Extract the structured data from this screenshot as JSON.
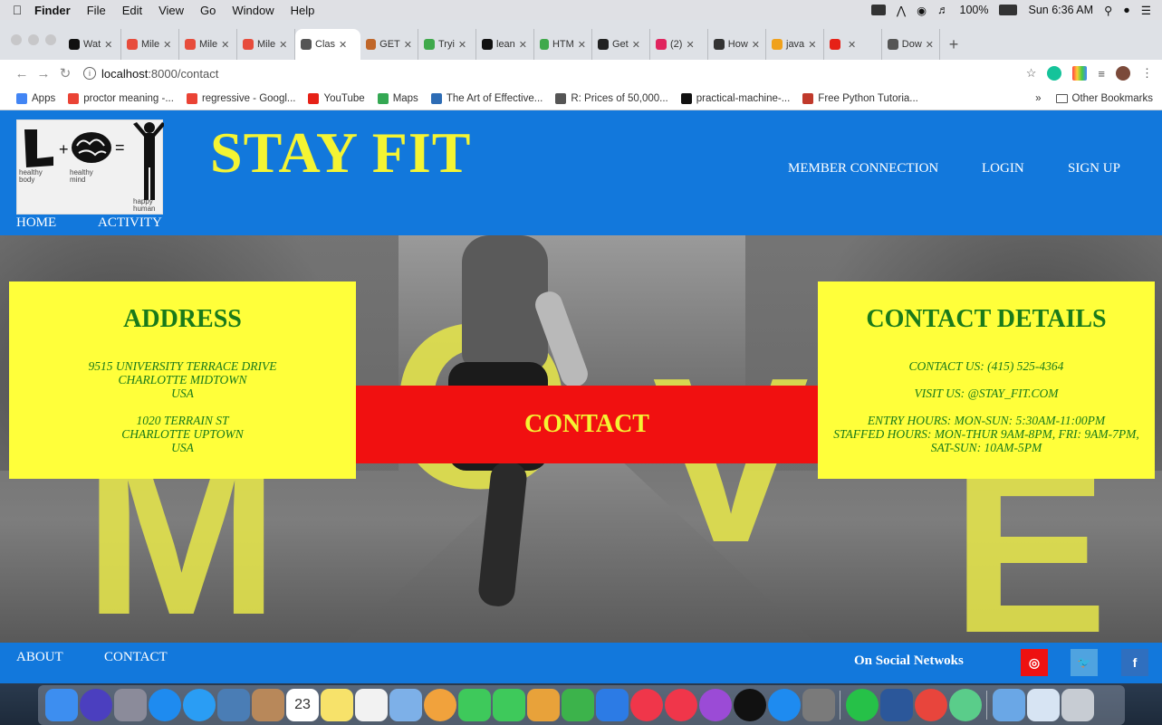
{
  "menubar": {
    "apple": "",
    "items": [
      "Finder",
      "File",
      "Edit",
      "View",
      "Go",
      "Window",
      "Help"
    ],
    "battery": "100%",
    "clock": "Sun 6:36 AM"
  },
  "browser": {
    "tabs": [
      {
        "label": "Wat",
        "color": "#111111"
      },
      {
        "label": "Mile",
        "color": "#e74c3c"
      },
      {
        "label": "Mile",
        "color": "#e74c3c"
      },
      {
        "label": "Mile",
        "color": "#e74c3c"
      },
      {
        "label": "Clas",
        "color": "#555555",
        "active": true
      },
      {
        "label": "GET",
        "color": "#c0672a"
      },
      {
        "label": "Tryi",
        "color": "#3fa94b"
      },
      {
        "label": "lean",
        "color": "#111111"
      },
      {
        "label": "HTM",
        "color": "#3fa94b"
      },
      {
        "label": "Get",
        "color": "#222222"
      },
      {
        "label": "(2)",
        "color": "#e0245e"
      },
      {
        "label": "How",
        "color": "#333333"
      },
      {
        "label": "java",
        "color": "#f0a11c"
      },
      {
        "label": "",
        "color": "#e62117"
      },
      {
        "label": "Dow",
        "color": "#555555"
      }
    ],
    "new_tab": "+",
    "url_host": "localhost",
    "url_path": ":8000/contact",
    "bookmarks": [
      {
        "label": "Apps",
        "color": "#4285f4"
      },
      {
        "label": "proctor meaning -...",
        "color": "#ea4335"
      },
      {
        "label": "regressive - Googl...",
        "color": "#ea4335"
      },
      {
        "label": "YouTube",
        "color": "#e62117"
      },
      {
        "label": "Maps",
        "color": "#34a853"
      },
      {
        "label": "The Art of Effective...",
        "color": "#2d6cb5"
      },
      {
        "label": "R: Prices of 50,000...",
        "color": "#555555"
      },
      {
        "label": "practical-machine-...",
        "color": "#111111"
      },
      {
        "label": "Free Python Tutoria...",
        "color": "#c0392b"
      }
    ],
    "overflow": "»",
    "other_bookmarks": "Other Bookmarks"
  },
  "site": {
    "title": "STAY FIT",
    "logo": {
      "body": "healthy\nbody",
      "mind": "healthy\nmind",
      "human": "happy\nhuman"
    },
    "topnav": [
      "MEMBER CONNECTION",
      "LOGIN",
      "SIGN UP"
    ],
    "subnav": [
      "HOME",
      "ACTIVITY"
    ],
    "hero_letters": [
      "M",
      "O",
      "V",
      "E"
    ],
    "address": {
      "heading": "ADDRESS",
      "line1a": "9515 UNIVERSITY TERRACE DRIVE",
      "line1b": "CHARLOTTE MIDTOWN",
      "line1c": "USA",
      "line2a": "1020 TERRAIN ST",
      "line2b": "CHARLOTTE UPTOWN",
      "line2c": "USA"
    },
    "contact_banner": "CONTACT",
    "contact_details": {
      "heading": "CONTACT DETAILS",
      "phone": "CONTACT US: (415) 525-4364",
      "visit": "VISIT US: @STAY_FIT.COM",
      "entry": "ENTRY HOURS: MON-SUN: 5:30AM-11:00PM",
      "staffed1": "STAFFED HOURS: MON-THUR 9AM-8PM, FRI: 9AM-7PM,",
      "staffed2": "SAT-SUN: 10AM-5PM"
    },
    "footer": {
      "links": [
        "ABOUT",
        "CONTACT"
      ],
      "social_label": "On Social Netwoks",
      "instagram": "◎",
      "twitter": "🐦",
      "facebook": "f"
    },
    "colors": {
      "header": "#1278dc",
      "title": "#f4f433",
      "panel": "#ffff3a",
      "panel_text": "#1a7a1a",
      "banner": "#f11010"
    }
  },
  "dock": {
    "apps": [
      {
        "name": "finder",
        "color": "#3d8ef0"
      },
      {
        "name": "siri",
        "color": "#4b3fbf"
      },
      {
        "name": "launchpad",
        "color": "#8b8b9a"
      },
      {
        "name": "safari",
        "color": "#1e8bf0"
      },
      {
        "name": "safari-alt",
        "color": "#2a9df4"
      },
      {
        "name": "preview",
        "color": "#4a7db5"
      },
      {
        "name": "contacts",
        "color": "#b8885a"
      },
      {
        "name": "calendar",
        "color": "#ffffff"
      },
      {
        "name": "notes",
        "color": "#f7e26a"
      },
      {
        "name": "reminders",
        "color": "#f2f2f2"
      },
      {
        "name": "photos-stack",
        "color": "#7db0e8"
      },
      {
        "name": "photos",
        "color": "#f1a23c"
      },
      {
        "name": "messages",
        "color": "#3ec95b"
      },
      {
        "name": "facetime",
        "color": "#3ec95b"
      },
      {
        "name": "pages",
        "color": "#e8a23a"
      },
      {
        "name": "numbers",
        "color": "#3cb34b"
      },
      {
        "name": "keynote",
        "color": "#2c7be5"
      },
      {
        "name": "news",
        "color": "#f0364a"
      },
      {
        "name": "music",
        "color": "#f0364a"
      },
      {
        "name": "podcasts",
        "color": "#9b4bd6"
      },
      {
        "name": "tv",
        "color": "#111111"
      },
      {
        "name": "app-store",
        "color": "#1e8bf0"
      },
      {
        "name": "system-preferences",
        "color": "#7a7a7a"
      },
      {
        "name": "whatsapp",
        "color": "#26c148"
      },
      {
        "name": "word",
        "color": "#2b579a"
      },
      {
        "name": "chrome",
        "color": "#e8453c"
      },
      {
        "name": "atom",
        "color": "#5acd8a"
      },
      {
        "name": "downloads",
        "color": "#6aa7e6"
      },
      {
        "name": "documents",
        "color": "#d7e4f3"
      },
      {
        "name": "trash",
        "color": "#c7ccd3"
      }
    ],
    "calendar_day": "23"
  }
}
